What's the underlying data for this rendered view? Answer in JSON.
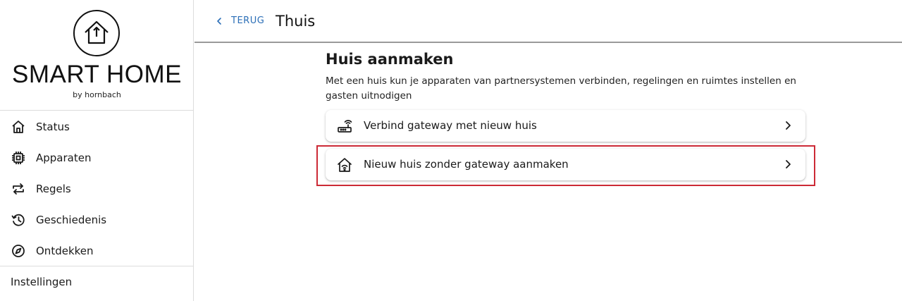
{
  "logo": {
    "title": "SMART HOME",
    "subtitle": "by hornbach"
  },
  "sidebar": {
    "items": [
      {
        "label": "Status",
        "icon": "home-icon"
      },
      {
        "label": "Apparaten",
        "icon": "chip-icon"
      },
      {
        "label": "Regels",
        "icon": "repeat-icon"
      },
      {
        "label": "Geschiedenis",
        "icon": "history-icon"
      },
      {
        "label": "Ontdekken",
        "icon": "compass-icon"
      }
    ],
    "settings_label": "Instellingen"
  },
  "header": {
    "back_label": "TERUG",
    "title": "Thuis"
  },
  "main": {
    "title": "Huis aanmaken",
    "description": "Met een huis kun je apparaten van partnersystemen verbinden, regelingen en ruimtes instellen en gasten uitnodigen",
    "options": [
      {
        "label": "Verbind gateway met nieuw huis",
        "icon": "router-icon"
      },
      {
        "label": "Nieuw huis zonder gateway aanmaken",
        "icon": "house-wifi-icon"
      }
    ]
  },
  "colors": {
    "accent": "#2c6fb7",
    "highlight": "#cc2a36"
  }
}
